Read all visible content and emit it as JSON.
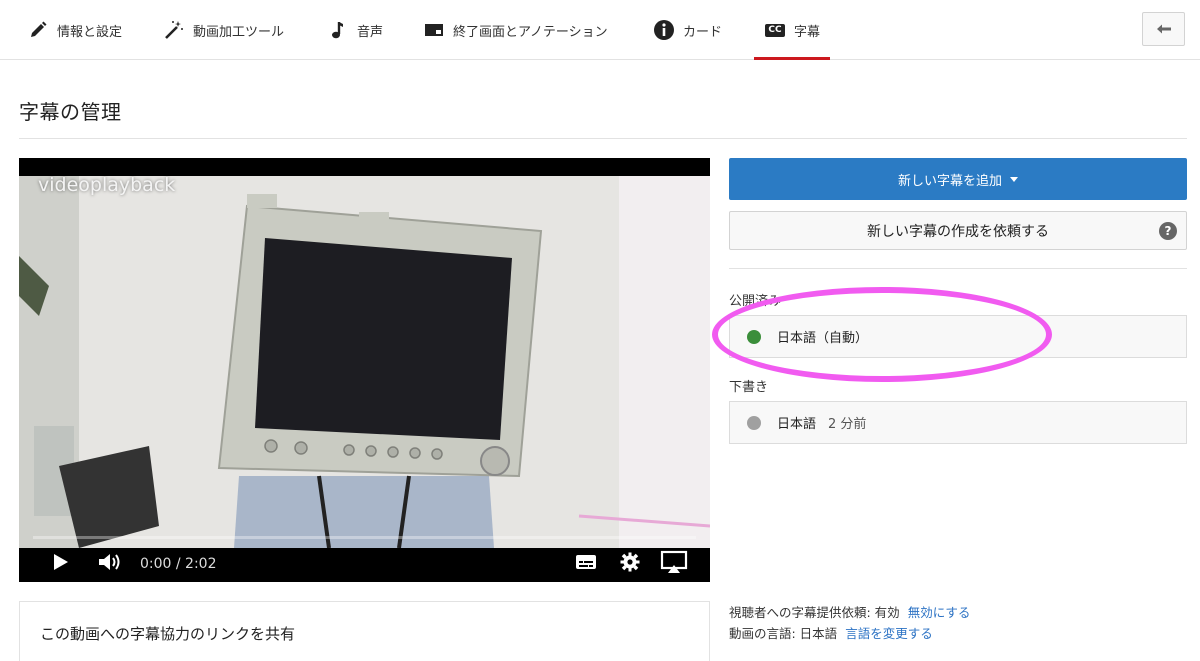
{
  "tabs": [
    {
      "label": "情報と設定",
      "icon": "pencil-icon"
    },
    {
      "label": "動画加工ツール",
      "icon": "magic-wand-icon"
    },
    {
      "label": "音声",
      "icon": "music-note-icon"
    },
    {
      "label": "終了画面とアノテーション",
      "icon": "end-screen-icon"
    },
    {
      "label": "カード",
      "icon": "info-icon"
    },
    {
      "label": "字幕",
      "icon": "cc-icon",
      "badge": "CC"
    }
  ],
  "active_tab": "字幕",
  "page": {
    "title": "字幕の管理"
  },
  "player": {
    "video_title": "videoplayback",
    "time": "0:00 / 2:02",
    "progress": 0.0
  },
  "actions": {
    "add_subtitles_label": "新しい字幕を追加",
    "request_subtitles_label": "新しい字幕の作成を依頼する",
    "help_glyph": "?"
  },
  "published": {
    "label": "公開済み",
    "items": [
      {
        "language": "日本語（自動）",
        "status_color": "#3b8e3a"
      }
    ]
  },
  "drafts": {
    "label": "下書き",
    "items": [
      {
        "language": "日本語",
        "age": "2 分前",
        "status_color": "#a0a0a0"
      }
    ]
  },
  "footer": {
    "viewer_contrib_text": "視聴者への字幕提供依頼: 有効",
    "viewer_contrib_link": "無効にする",
    "video_language_text": "動画の言語: 日本語",
    "video_language_link": "言語を変更する"
  },
  "share": {
    "title": "この動画への字幕協力のリンクを共有"
  },
  "colors": {
    "accent_red": "#cc181e",
    "primary_blue": "#2b7bc4",
    "highlight_pink": "#f15bf0"
  }
}
